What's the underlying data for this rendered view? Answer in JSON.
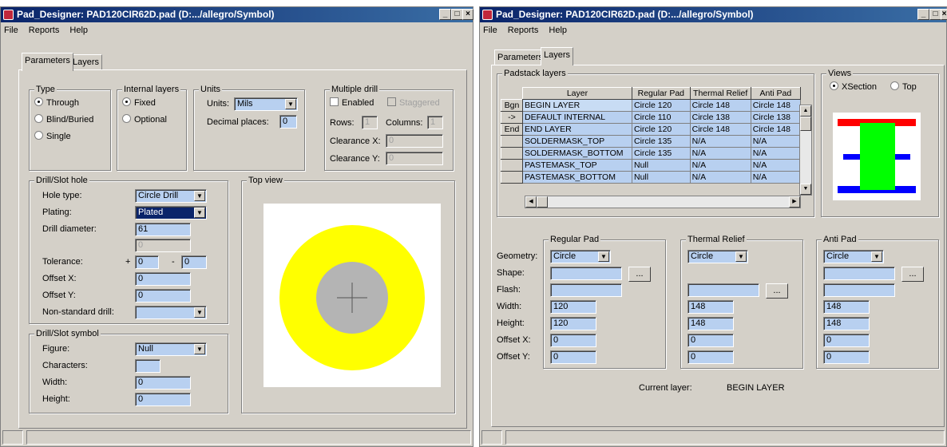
{
  "left_window": {
    "title": "Pad_Designer: PAD120CIR62D.pad (D:.../allegro/Symbol)",
    "menu": [
      "File",
      "Reports",
      "Help"
    ],
    "tabs": [
      "Parameters",
      "Layers"
    ],
    "type": {
      "label": "Type",
      "options": [
        "Through",
        "Blind/Buried",
        "Single"
      ],
      "selected": "Through"
    },
    "internal_layers": {
      "label": "Internal layers",
      "options": [
        "Fixed",
        "Optional"
      ],
      "selected": "Fixed"
    },
    "units": {
      "label": "Units",
      "units_label": "Units:",
      "units_value": "Mils",
      "decimal_label": "Decimal places:",
      "decimal_value": "0"
    },
    "multiple_drill": {
      "label": "Multiple drill",
      "enabled": "Enabled",
      "staggered": "Staggered",
      "rows_label": "Rows:",
      "rows_value": "1",
      "columns_label": "Columns:",
      "columns_value": "1",
      "clearance_x_label": "Clearance X:",
      "clearance_x_value": "0",
      "clearance_y_label": "Clearance Y:",
      "clearance_y_value": "0"
    },
    "drill_hole": {
      "label": "Drill/Slot hole",
      "hole_type_label": "Hole type:",
      "hole_type_value": "Circle Drill",
      "plating_label": "Plating:",
      "plating_value": "Plated",
      "drill_diameter_label": "Drill diameter:",
      "drill_diameter_value": "61",
      "extra_value": "0",
      "tolerance_label": "Tolerance:",
      "plus": "+",
      "tolerance_plus": "0",
      "minus": "-",
      "tolerance_minus": "0",
      "offset_x_label": "Offset X:",
      "offset_x_value": "0",
      "offset_y_label": "Offset Y:",
      "offset_y_value": "0",
      "non_standard_label": "Non-standard drill:",
      "non_standard_value": ""
    },
    "drill_symbol": {
      "label": "Drill/Slot symbol",
      "figure_label": "Figure:",
      "figure_value": "Null",
      "characters_label": "Characters:",
      "characters_value": "",
      "width_label": "Width:",
      "width_value": "0",
      "height_label": "Height:",
      "height_value": "0"
    },
    "top_view": {
      "label": "Top view",
      "pad_color": "#ffff00",
      "drill_color": "#b4b4b4"
    }
  },
  "right_window": {
    "title": "Pad_Designer: PAD120CIR62D.pad (D:.../allegro/Symbol)",
    "menu": [
      "File",
      "Reports",
      "Help"
    ],
    "tabs": [
      "Parameters",
      "Layers"
    ],
    "padstack_layers": {
      "label": "Padstack layers",
      "headers": [
        "Layer",
        "Regular Pad",
        "Thermal Relief",
        "Anti Pad"
      ],
      "rows": [
        {
          "btn": "Bgn",
          "layer": "BEGIN LAYER",
          "regular": "Circle 120",
          "thermal": "Circle 148",
          "anti": "Circle 148"
        },
        {
          "btn": "->",
          "layer": "DEFAULT INTERNAL",
          "regular": "Circle 110",
          "thermal": "Circle 138",
          "anti": "Circle 138"
        },
        {
          "btn": "End",
          "layer": "END LAYER",
          "regular": "Circle 120",
          "thermal": "Circle 148",
          "anti": "Circle 148"
        },
        {
          "btn": "",
          "layer": "SOLDERMASK_TOP",
          "regular": "Circle 135",
          "thermal": "N/A",
          "anti": "N/A"
        },
        {
          "btn": "",
          "layer": "SOLDERMASK_BOTTOM",
          "regular": "Circle 135",
          "thermal": "N/A",
          "anti": "N/A"
        },
        {
          "btn": "",
          "layer": "PASTEMASK_TOP",
          "regular": "Null",
          "thermal": "N/A",
          "anti": "N/A"
        },
        {
          "btn": "",
          "layer": "PASTEMASK_BOTTOM",
          "regular": "Null",
          "thermal": "N/A",
          "anti": "N/A"
        }
      ]
    },
    "views": {
      "label": "Views",
      "xsection": "XSection",
      "top": "Top",
      "selected": "XSection",
      "red": "#ff0000",
      "green": "#00ff00",
      "blue": "#0000ff"
    },
    "row_labels": {
      "geometry": "Geometry:",
      "shape": "Shape:",
      "flash": "Flash:",
      "width": "Width:",
      "height": "Height:",
      "offset_x": "Offset X:",
      "offset_y": "Offset Y:"
    },
    "regular_pad": {
      "label": "Regular Pad",
      "geometry": "Circle",
      "width": "120",
      "height": "120",
      "offset_x": "0",
      "offset_y": "0"
    },
    "thermal_relief": {
      "label": "Thermal Relief",
      "geometry": "Circle",
      "width": "148",
      "height": "148",
      "offset_x": "0",
      "offset_y": "0"
    },
    "anti_pad": {
      "label": "Anti Pad",
      "geometry": "Circle",
      "width": "148",
      "height": "148",
      "offset_x": "0",
      "offset_y": "0"
    },
    "browse": "...",
    "current_layer_label": "Current layer:",
    "current_layer_value": "BEGIN LAYER"
  }
}
